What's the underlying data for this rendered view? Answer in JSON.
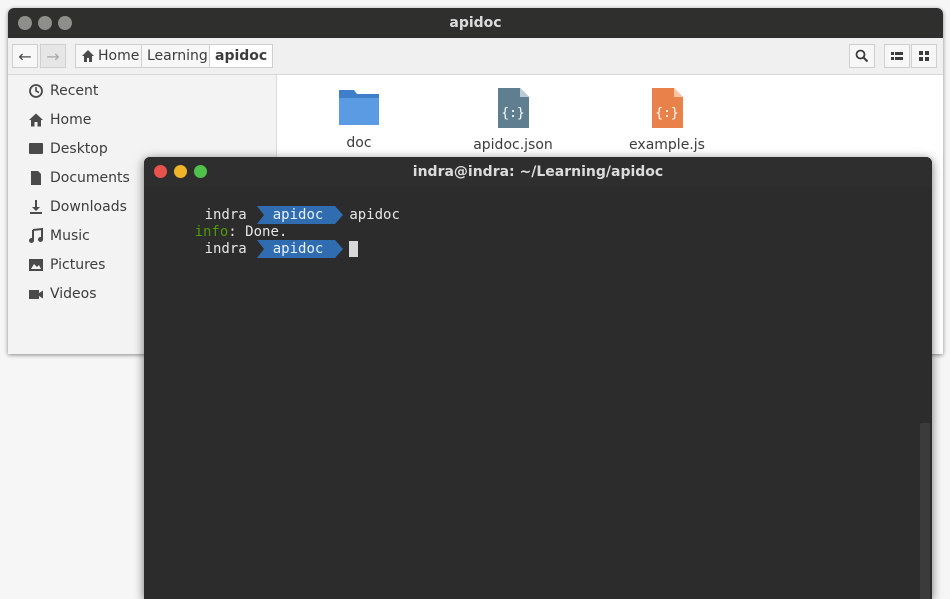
{
  "file_manager": {
    "title": "apidoc",
    "toolbar": {
      "back_icon": "arrow-left-icon",
      "forward_icon": "arrow-right-icon",
      "breadcrumbs": [
        {
          "label": "Home",
          "icon": "home-icon"
        },
        {
          "label": "Learning"
        },
        {
          "label": "apidoc"
        }
      ],
      "search_icon": "search-icon",
      "list_view_icon": "list-view-icon",
      "grid_view_icon": "grid-view-icon"
    },
    "sidebar": {
      "items": [
        {
          "label": "Recent",
          "icon": "clock-icon"
        },
        {
          "label": "Home",
          "icon": "home-icon"
        },
        {
          "label": "Desktop",
          "icon": "desktop-icon"
        },
        {
          "label": "Documents",
          "icon": "document-icon"
        },
        {
          "label": "Downloads",
          "icon": "download-icon"
        },
        {
          "label": "Music",
          "icon": "music-icon"
        },
        {
          "label": "Pictures",
          "icon": "picture-icon"
        },
        {
          "label": "Videos",
          "icon": "video-icon"
        }
      ]
    },
    "files": [
      {
        "name": "doc",
        "icon": "folder-icon",
        "color": "#4a90d9"
      },
      {
        "name": "apidoc.json",
        "icon": "json-file-icon",
        "color": "#5a7a8c"
      },
      {
        "name": "example.js",
        "icon": "js-file-icon",
        "color": "#e8824a"
      }
    ]
  },
  "terminal": {
    "title": "indra@indra: ~/Learning/apidoc",
    "lines": [
      {
        "user": "indra",
        "dir": "apidoc",
        "command": "apidoc"
      },
      {
        "info_key": "info",
        "info_text": ": Done."
      },
      {
        "user": "indra",
        "dir": "apidoc",
        "command": ""
      }
    ],
    "colors": {
      "dir_bg": "#2f6db0",
      "info": "#4e9a06",
      "close": "#e8524a",
      "minimize": "#f0b429",
      "maximize": "#4ec24a"
    }
  }
}
